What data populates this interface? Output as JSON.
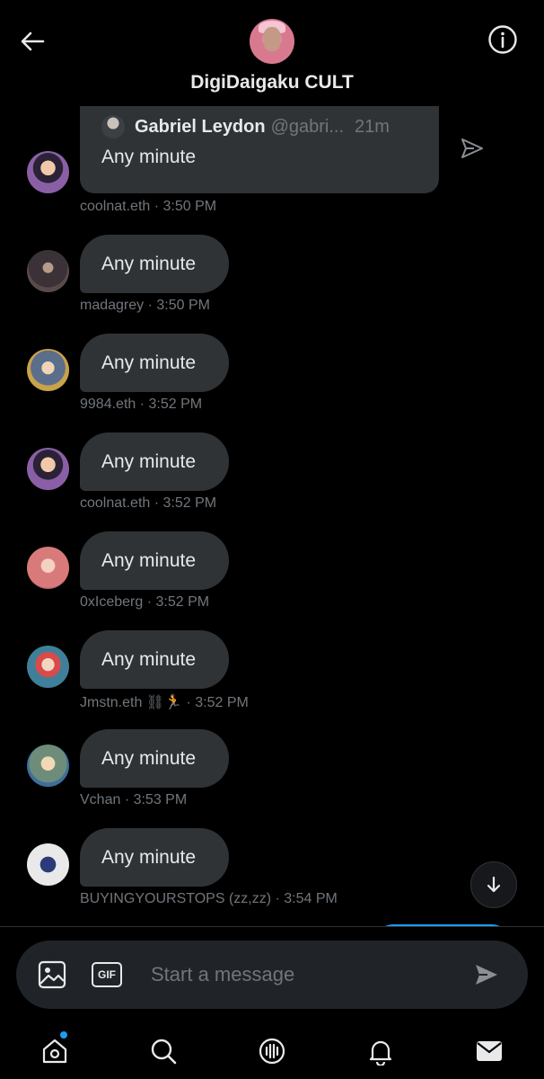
{
  "header": {
    "title": "DigiDaigaku CULT",
    "back_icon": "arrow-left-icon",
    "info_icon": "info-icon"
  },
  "quote": {
    "name": "Gabriel Leydon",
    "handle": "@gabri...",
    "time": "21m",
    "text": "Any minute",
    "meta": "coolnat.eth · 3:50 PM"
  },
  "messages": [
    {
      "text": "Any minute",
      "meta": "madagrey · 3:50 PM",
      "avatar_color": "#3a3236"
    },
    {
      "text": "Any minute",
      "meta": "9984.eth · 3:52 PM",
      "avatar_color": "#5b6e8c"
    },
    {
      "text": "Any minute",
      "meta": "coolnat.eth · 3:52 PM",
      "avatar_color": "#8a5fa6"
    },
    {
      "text": "Any minute",
      "meta": "0xIceberg · 3:52 PM",
      "avatar_color": "#c98a8a"
    },
    {
      "text": "Any minute",
      "meta": "Jmstn.eth ⛓🏃 · 3:52 PM",
      "avatar_color": "#3f7f9a"
    },
    {
      "text": "Any minute",
      "meta": "Vchan · 3:53 PM",
      "avatar_color": "#6e8c7a"
    },
    {
      "text": "Any minute",
      "meta": "BUYINGYOURSTOPS (zz,zz) · 3:54 PM",
      "avatar_color": "#e9e9e9"
    }
  ],
  "composer": {
    "placeholder": "Start a message",
    "gif_label": "GIF"
  },
  "tabs": [
    "home-icon",
    "search-icon",
    "spaces-icon",
    "notifications-icon",
    "messages-icon"
  ],
  "colors": {
    "background": "#000000",
    "bubble": "#2f3336",
    "accent": "#1d9bf0",
    "secondary_text": "#71767b"
  }
}
